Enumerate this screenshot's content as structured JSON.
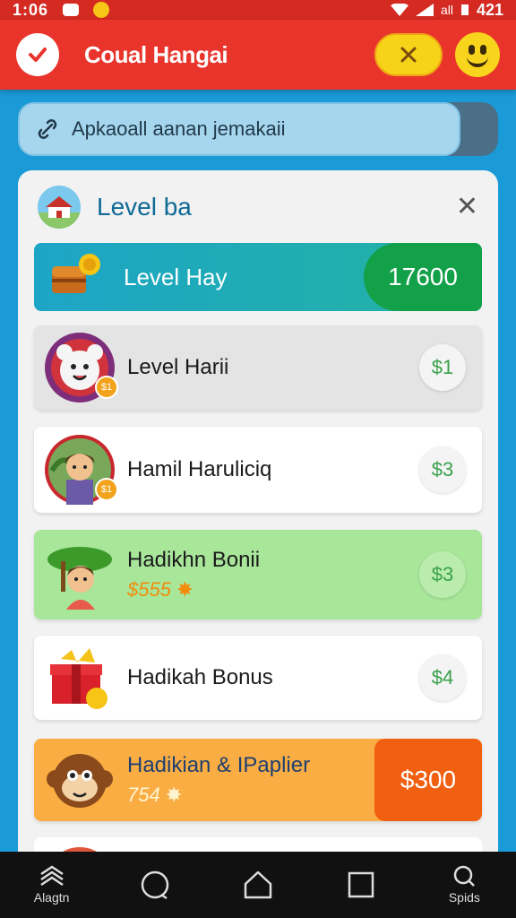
{
  "status": {
    "time": "1:06",
    "signal": "all",
    "battery": "421"
  },
  "header": {
    "title": "Coual Hangai"
  },
  "search": {
    "text": "Apkaoall aanan jemakaii"
  },
  "modal": {
    "title": "Level ba",
    "featured": {
      "label": "Level Hay",
      "value": "17600"
    },
    "items": [
      {
        "title": "Level Harii",
        "price": "$1",
        "badge": "$1"
      },
      {
        "title": "Hamil Haruliciq",
        "price": "$3",
        "badge": "$1"
      },
      {
        "title": "Hadikhn Bonii",
        "sub": "$555",
        "price": "$3"
      },
      {
        "title": "Hadikah Bonus",
        "price": "$4"
      },
      {
        "title": "Hadikian & IPaplier",
        "sub": "754",
        "price": "$300"
      }
    ]
  },
  "nav": {
    "home_label": "Alagtn",
    "search_label": "Spids"
  },
  "colors": {
    "appbar": "#e8342b",
    "bg": "#1a9ad6",
    "green": "#12a049",
    "orange": "#f06010"
  }
}
